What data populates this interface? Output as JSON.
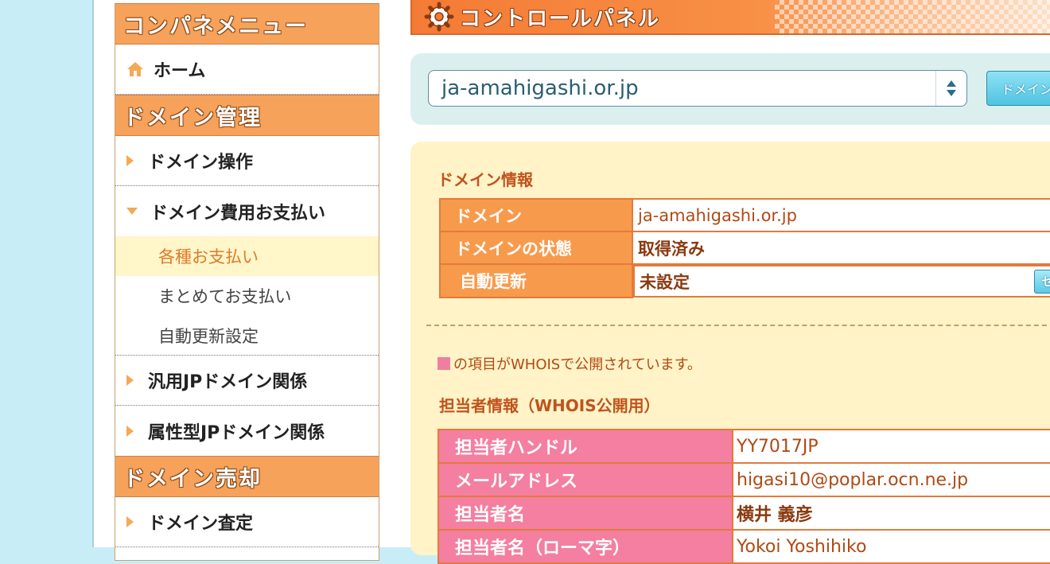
{
  "sidebar": {
    "menu_title": "コンパネメニュー",
    "home": "ホーム",
    "domain_mgmt_title": "ドメイン管理",
    "domain_ops": "ドメイン操作",
    "domain_fees": "ドメイン費用お支払い",
    "sub_items": [
      "各種お支払い",
      "まとめてお支払い",
      "自動更新設定"
    ],
    "generic_jp": "汎用JPドメイン関係",
    "attr_jp": "属性型JPドメイン関係",
    "domain_sale_title": "ドメイン売却",
    "domain_appraisal": "ドメイン査定"
  },
  "header": {
    "title": "コントロールパネル"
  },
  "domain_selector": {
    "selected": "ja-amahigashi.or.jp",
    "button_label": "ドメイン"
  },
  "domain_info": {
    "title": "ドメイン情報",
    "rows": [
      {
        "key": "ドメイン",
        "value": "ja-amahigashi.or.jp"
      },
      {
        "key": "ドメインの状態",
        "value": "取得済み"
      },
      {
        "key": "自動更新",
        "value": "未設定"
      }
    ],
    "set_button": "セット"
  },
  "whois_notice": "の項目がWHOISで公開されています。",
  "contact_info": {
    "title": "担当者情報（WHOIS公開用）",
    "rows": [
      {
        "key": "担当者ハンドル",
        "value": "YY7017JP"
      },
      {
        "key": "メールアドレス",
        "value": "higasi10@poplar.ocn.ne.jp"
      },
      {
        "key": "担当者名",
        "value": "横井 義彦"
      },
      {
        "key": "担当者名（ローマ字）",
        "value": "Yokoi Yoshihiko"
      }
    ]
  },
  "colors": {
    "accent_orange": "#f89a4c",
    "whois_pink": "#f47fa0",
    "panel_cream": "#fff3c7",
    "page_bg": "#c9edf6"
  }
}
